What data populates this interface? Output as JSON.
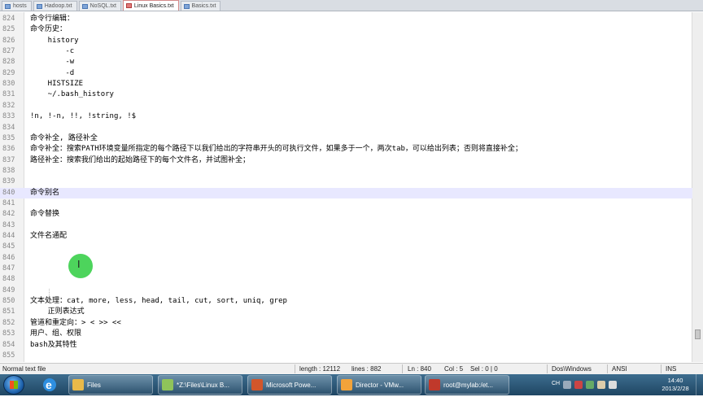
{
  "tabs": [
    {
      "label": "hosts"
    },
    {
      "label": "Hadoop.txt"
    },
    {
      "label": "NoSQL.txt"
    },
    {
      "label": "Linux Basics.txt"
    },
    {
      "label": "Basics.txt"
    }
  ],
  "editor": {
    "lines": [
      {
        "num": "824",
        "text": "命令行编辑："
      },
      {
        "num": "825",
        "text": "命令历史："
      },
      {
        "num": "826",
        "text": "    history"
      },
      {
        "num": "827",
        "text": "        -c"
      },
      {
        "num": "828",
        "text": "        -w"
      },
      {
        "num": "829",
        "text": "        -d"
      },
      {
        "num": "830",
        "text": "    HISTSIZE"
      },
      {
        "num": "831",
        "text": "    ~/.bash_history"
      },
      {
        "num": "832",
        "text": ""
      },
      {
        "num": "833",
        "text": "!n, !-n, !!, !string, !$"
      },
      {
        "num": "834",
        "text": ""
      },
      {
        "num": "835",
        "text": "命令补全, 路径补全"
      },
      {
        "num": "836",
        "text": "命令补全：搜索PATH环境变量所指定的每个路径下以我们给出的字符串开头的可执行文件，如果多于一个，两次tab，可以给出列表；否则将直接补全；"
      },
      {
        "num": "837",
        "text": "路径补全：搜索我们给出的起始路径下的每个文件名，并试图补全；"
      },
      {
        "num": "838",
        "text": ""
      },
      {
        "num": "839",
        "text": ""
      },
      {
        "num": "840",
        "text": "命令别名"
      },
      {
        "num": "841",
        "text": ""
      },
      {
        "num": "842",
        "text": "命令替换"
      },
      {
        "num": "843",
        "text": ""
      },
      {
        "num": "844",
        "text": "文件名通配"
      },
      {
        "num": "845",
        "text": ""
      },
      {
        "num": "846",
        "text": ""
      },
      {
        "num": "847",
        "text": ""
      },
      {
        "num": "848",
        "text": ""
      },
      {
        "num": "849",
        "text": ""
      },
      {
        "num": "850",
        "text": "文本处理：cat, more, less, head, tail, cut, sort, uniq, grep"
      },
      {
        "num": "851",
        "text": "    正则表达式"
      },
      {
        "num": "852",
        "text": "管道和重定向：> < >> <<"
      },
      {
        "num": "853",
        "text": "用户、组、权限"
      },
      {
        "num": "854",
        "text": "bash及其特性"
      },
      {
        "num": "855",
        "text": ""
      }
    ],
    "current_line": "840"
  },
  "status": {
    "file_type": "Normal text file",
    "length": "length : 12112",
    "lines": "lines : 882",
    "ln": "Ln : 840",
    "col": "Col : 5",
    "sel": "Sel : 0 | 0",
    "eol": "Dos\\Windows",
    "encoding": "ANSI",
    "mode": "INS"
  },
  "taskbar": {
    "buttons": [
      {
        "label": "Files",
        "icon": "folder-icon",
        "color": "#e9b949"
      },
      {
        "label": "*Z:\\Files\\Linux B...",
        "icon": "notepadpp-icon",
        "color": "#8fc35a"
      },
      {
        "label": "Microsoft Powe...",
        "icon": "powerpoint-icon",
        "color": "#d2562b"
      },
      {
        "label": "Director - VMw...",
        "icon": "vmware-icon",
        "color": "#f2a33a"
      },
      {
        "label": "root@mylab:/et...",
        "icon": "terminal-icon",
        "color": "#c0392b"
      }
    ],
    "tray_text": "CH",
    "clock_time": "14:40",
    "clock_date": "2013/2/28"
  }
}
